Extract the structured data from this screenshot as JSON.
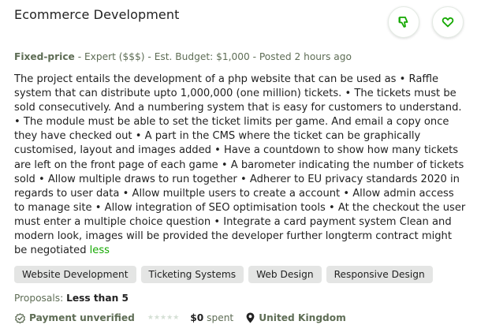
{
  "job": {
    "title": "Ecommerce Development",
    "job_type": "Fixed-price",
    "meta_rest": " - Expert ($$$) - Est. Budget: $1,000 - Posted 2 hours ago",
    "description": "The project entails the development of a php website that can be used as • Raffle system that can distribute upto 1,000,000 (one million) tickets. • The tickets must be sold consecutively. And a numbering system that is easy for customers to understand. • The module must be able to set the ticket limits per game. And email a copy once they have checked out • A part in the CMS where the ticket can be graphically customised, layout and images added • Have a countdown to show how many tickets are left on the front page of each game • A barometer indicating the number of tickets sold • Allow multiple draws to run together • Adherer to EU privacy standards 2020 in regards to user data • Allow muiltple users to create a account • Allow admin access to manage site • Allow integration of SEO optimisation tools • At the checkout the user must enter a multiple choice question • Integrate a card payment system Clean and modern look, images will be provided the developer further longterm contract might be negotiated ",
    "less_label": "less",
    "skills": [
      "Website Development",
      "Ticketing Systems",
      "Web Design",
      "Responsive Design"
    ],
    "proposals_label": "Proposals: ",
    "proposals_value": "Less than 5"
  },
  "client": {
    "payment_status": "Payment unverified",
    "rating_stars": 0,
    "spent_amount": "$0",
    "spent_label": " spent",
    "location": "United Kingdom"
  },
  "actions": {
    "dislike_icon": "thumbs-down-icon",
    "save_icon": "heart-icon"
  },
  "colors": {
    "accent_green": "#14a800",
    "muted_text": "#5e6d55",
    "tag_bg": "#e4e5e4",
    "star_empty": "#d5e0d5"
  }
}
